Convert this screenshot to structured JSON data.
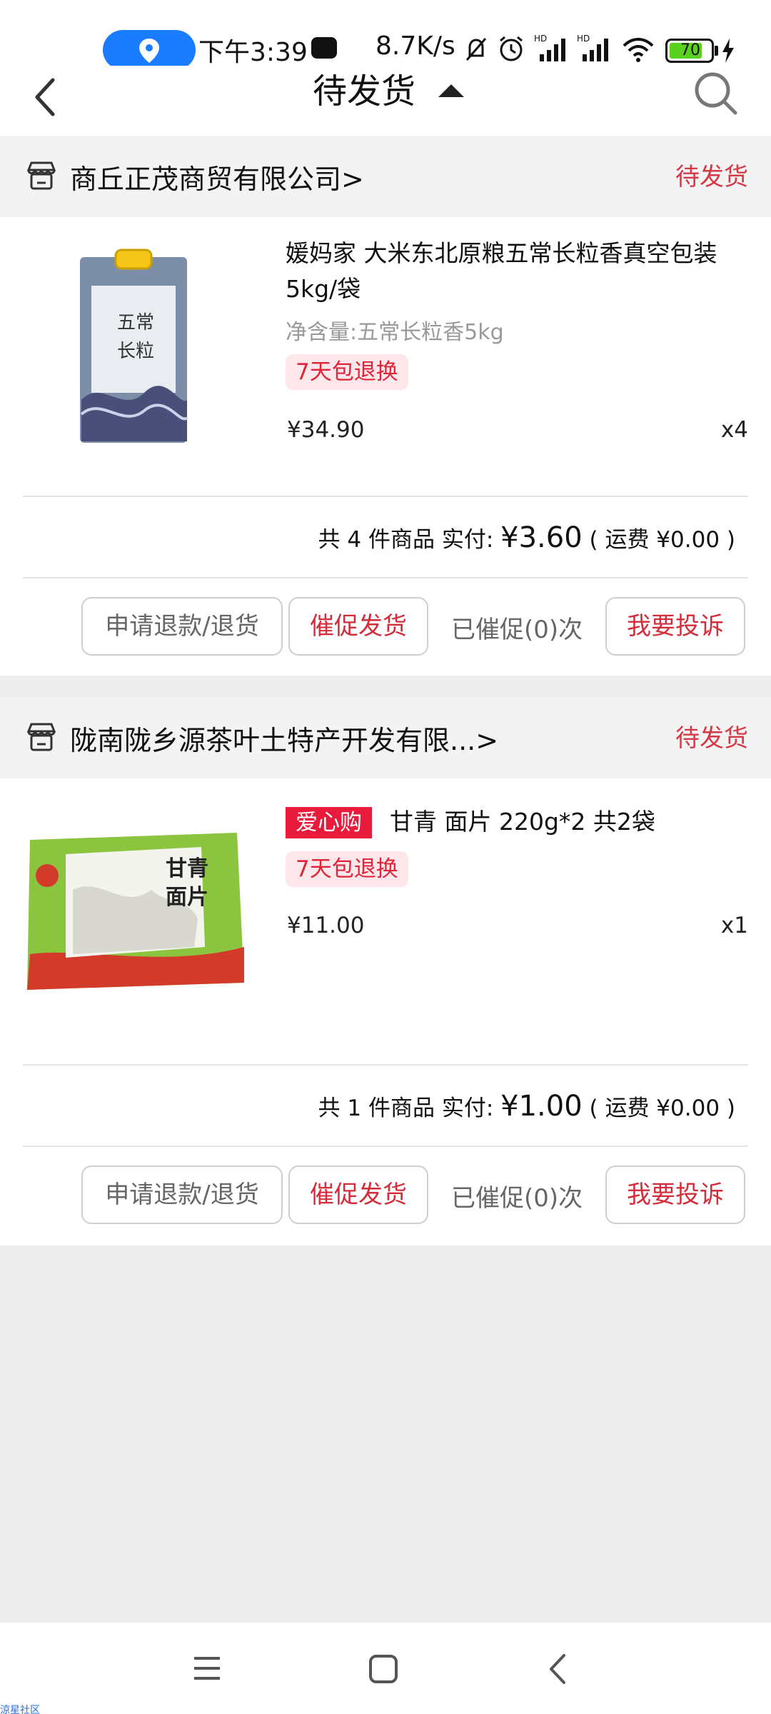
{
  "status_bar": {
    "time": "下午3:39",
    "net_speed": "8.7K/s",
    "battery": "70",
    "icons": [
      "location-icon",
      "app-icon",
      "mute-bell-icon",
      "alarm-icon",
      "hd-signal-icon",
      "hd-signal-icon",
      "wifi-icon",
      "battery-icon",
      "charging-icon"
    ]
  },
  "header": {
    "title": "待发货",
    "back_icon": "chevron-left-icon",
    "search_icon": "search-icon"
  },
  "orders": [
    {
      "shop_name": "商丘正茂商贸有限公司>",
      "status": "待发货",
      "product": {
        "title": "媛妈家 大米东北原粮五常长粒香真空包装5kg/袋",
        "spec": "净含量:五常长粒香5kg",
        "tag": "7天包退换",
        "price": "¥34.90",
        "qty": "x4"
      },
      "summary": {
        "count_text": "共 4 件商品 实付: ",
        "amount": "¥3.60",
        "shipping": "( 运费 ¥0.00 )"
      },
      "actions": {
        "refund": "申请退款/退货",
        "urge": "催促发货",
        "urge_count": "已催促(0)次",
        "complain": "我要投诉"
      }
    },
    {
      "shop_name": "陇南陇乡源茶叶土特产开发有限...>",
      "status": "待发货",
      "product": {
        "badge": "爱心购",
        "title": "甘青 面片 220g*2 共2袋",
        "tag": "7天包退换",
        "price": "¥11.00",
        "qty": "x1"
      },
      "summary": {
        "count_text": "共 1 件商品 实付: ",
        "amount": "¥1.00",
        "shipping": "( 运费 ¥0.00 )"
      },
      "actions": {
        "refund": "申请退款/退货",
        "urge": "催促发货",
        "urge_count": "已催促(0)次",
        "complain": "我要投诉"
      }
    }
  ],
  "nav": {
    "menu_icon": "menu-icon",
    "home_icon": "home-square-icon",
    "back_icon": "back-triangle-icon"
  },
  "watermark": "涼星社区",
  "colors": {
    "accent_red": "#d43a45",
    "tag_bg": "#fde7ea",
    "love_badge": "#e81b3c",
    "location_pill": "#1a7cff"
  }
}
